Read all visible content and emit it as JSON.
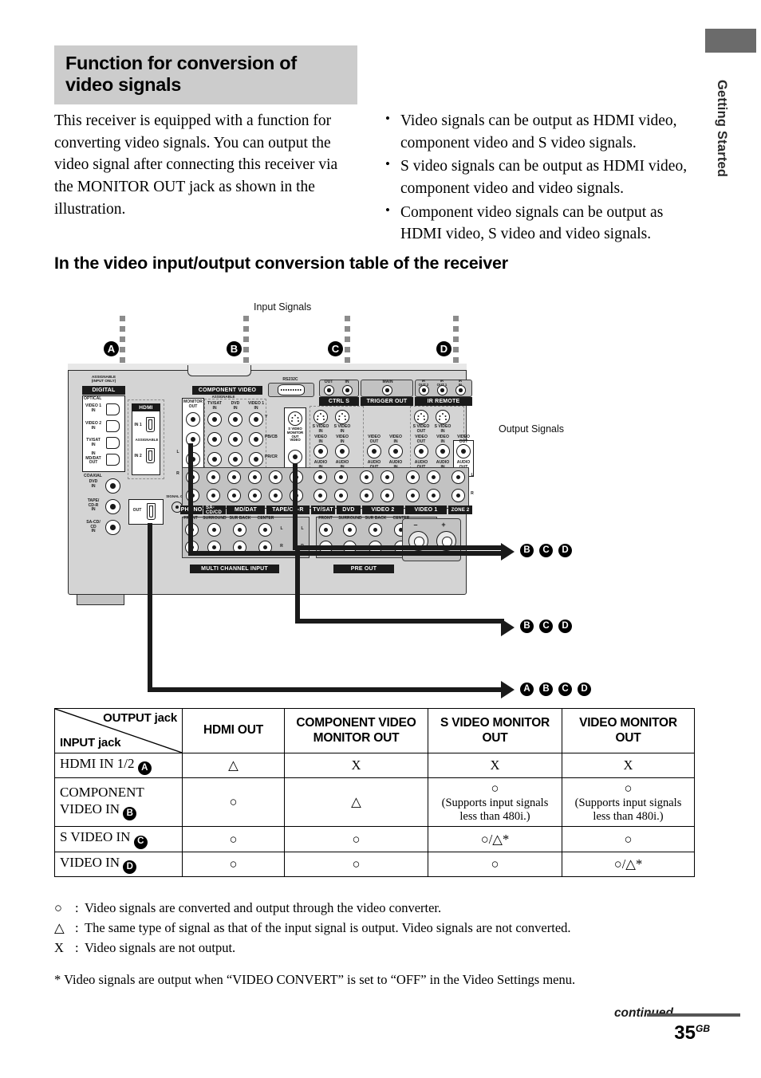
{
  "side_tab": {
    "label": "Getting Started"
  },
  "title": "Function for conversion of video signals",
  "intro_paragraph": "This receiver is equipped with a function for converting video signals. You can output the video signal after connecting this receiver via the MONITOR OUT jack as shown in the illustration.",
  "intro_bullets": [
    "Video signals can be output as HDMI video, component video and S video signals.",
    "S video signals can be output as HDMI video, component video and video signals.",
    "Component video signals can be output as HDMI video, S video and video signals."
  ],
  "section_heading": "In the video input/output conversion table of the receiver",
  "diagram": {
    "input_signals_label": "Input Signals",
    "output_signals_label": "Output Signals",
    "input_markers": [
      "A",
      "B",
      "C",
      "D"
    ],
    "output_rows": [
      {
        "badges": [
          "B",
          "C",
          "D"
        ]
      },
      {
        "badges": [
          "B",
          "C",
          "D"
        ]
      },
      {
        "badges": [
          "A",
          "B",
          "C",
          "D"
        ]
      }
    ],
    "panel": {
      "digital_title": "DIGITAL",
      "digital_assignable": "ASSIGNABLE\n(INPUT ONLY)",
      "optical_label": "OPTICAL",
      "coaxial_label": "COAXIAL",
      "digital_jacks": [
        "VIDEO 1\nIN",
        "VIDEO 2\nIN",
        "TV/SAT\nIN",
        "IN\nMD/DAT\nOUT"
      ],
      "coaxial_jacks": [
        "DVD\nIN",
        "TAPE/\nCD-R\nIN",
        "SA-CD/\nCD\nIN"
      ],
      "hdmi_title": "HDMI",
      "hdmi_in1": "IN 1",
      "hdmi_in2": "IN 2",
      "hdmi_assignable": "ASSIGNABLE",
      "hdmi_out": "OUT",
      "signal_gnd": "SIGNAL GND",
      "component_title": "COMPONENT VIDEO",
      "component_assignable": "ASSIGNABLE",
      "component_jacks": [
        "MONITOR\nOUT",
        "TV/SAT\nIN",
        "DVD\nIN",
        "VIDEO 1\nIN"
      ],
      "component_rows": [
        "Y",
        "PB/CB",
        "PR/CR"
      ],
      "rs232c": "RS232C",
      "ctrl_s_title": "CTRL S",
      "ctrl_s_jacks": [
        "OUT",
        "IN"
      ],
      "trigger_title": "TRIGGER OUT",
      "trigger_jack": "MAIN",
      "ir_title": "IR REMOTE",
      "ir_jacks": [
        "IR\nOUT 2",
        "IR\nOUT 1",
        "IR\nIN"
      ],
      "svideo_monitor": "S VIDEO\nMONITOR\nOUT\nVIDEO",
      "video_io_labels": [
        "S VIDEO\nIN",
        "S VIDEO\nIN",
        "S VIDEO\nOUT",
        "S VIDEO\nIN",
        "S VIDEO\nOUT",
        "S VIDEO\nIN"
      ],
      "video_row_labels": [
        "VIDEO\nIN",
        "VIDEO\nIN",
        "VIDEO\nOUT",
        "VIDEO\nIN",
        "VIDEO\nOUT",
        "VIDEO\nIN",
        "VIDEO\nOUT"
      ],
      "audio_row_labels": [
        "AUDIO\nIN",
        "AUDIO\nIN",
        "AUDIO\nOUT",
        "AUDIO\nIN",
        "AUDIO\nOUT",
        "AUDIO\nIN",
        "AUDIO\nOUT"
      ],
      "bottom_sections": [
        "PHONO",
        "SA-CD/CD",
        "MD/DAT",
        "TAPE/CD-R",
        "TV/SAT",
        "DVD",
        "VIDEO 2",
        "VIDEO 1",
        "ZONE 2"
      ],
      "multi_channel_input": "MULTI CHANNEL INPUT",
      "pre_out": "PRE OUT",
      "multi_labels": [
        "FRONT",
        "SURROUND",
        "SUR BACK",
        "CENTER"
      ],
      "pre_labels": [
        "FRONT",
        "SURROUND",
        "SUR BACK",
        "CENTER"
      ],
      "lr_labels": [
        "L",
        "R"
      ],
      "speaker_signs": [
        "–",
        "+"
      ]
    }
  },
  "table": {
    "corner_output": "OUTPUT jack",
    "corner_input": "INPUT jack",
    "columns": [
      "HDMI OUT",
      "COMPONENT VIDEO MONITOR OUT",
      "S VIDEO MONITOR OUT",
      "VIDEO MONITOR OUT"
    ],
    "rows": [
      {
        "label": "HDMI IN 1/2",
        "badge": "A",
        "cells": [
          {
            "symbol": "△",
            "note": ""
          },
          {
            "symbol": "X",
            "note": ""
          },
          {
            "symbol": "X",
            "note": ""
          },
          {
            "symbol": "X",
            "note": ""
          }
        ]
      },
      {
        "label": "COMPONENT VIDEO IN",
        "badge": "B",
        "cells": [
          {
            "symbol": "○",
            "note": ""
          },
          {
            "symbol": "△",
            "note": ""
          },
          {
            "symbol": "○",
            "note": "(Supports input signals less than 480i.)"
          },
          {
            "symbol": "○",
            "note": "(Supports input signals less than 480i.)"
          }
        ]
      },
      {
        "label": "S VIDEO IN",
        "badge": "C",
        "cells": [
          {
            "symbol": "○",
            "note": ""
          },
          {
            "symbol": "○",
            "note": ""
          },
          {
            "symbol": "○/△*",
            "note": ""
          },
          {
            "symbol": "○",
            "note": ""
          }
        ]
      },
      {
        "label": "VIDEO IN",
        "badge": "D",
        "cells": [
          {
            "symbol": "○",
            "note": ""
          },
          {
            "symbol": "○",
            "note": ""
          },
          {
            "symbol": "○",
            "note": ""
          },
          {
            "symbol": "○/△*",
            "note": ""
          }
        ]
      }
    ]
  },
  "legend": [
    {
      "symbol": "○",
      "text": "Video signals are converted and output through the video converter."
    },
    {
      "symbol": "△",
      "text": "The same type of signal as that of the input signal is output. Video signals are not converted."
    },
    {
      "symbol": "X",
      "text": "Video signals are not output."
    }
  ],
  "footnote": "* Video signals are output when “VIDEO CONVERT” is set to “OFF” in the Video Settings menu.",
  "footer": {
    "continued": "continued",
    "page_number": "35",
    "page_suffix": "GB"
  }
}
